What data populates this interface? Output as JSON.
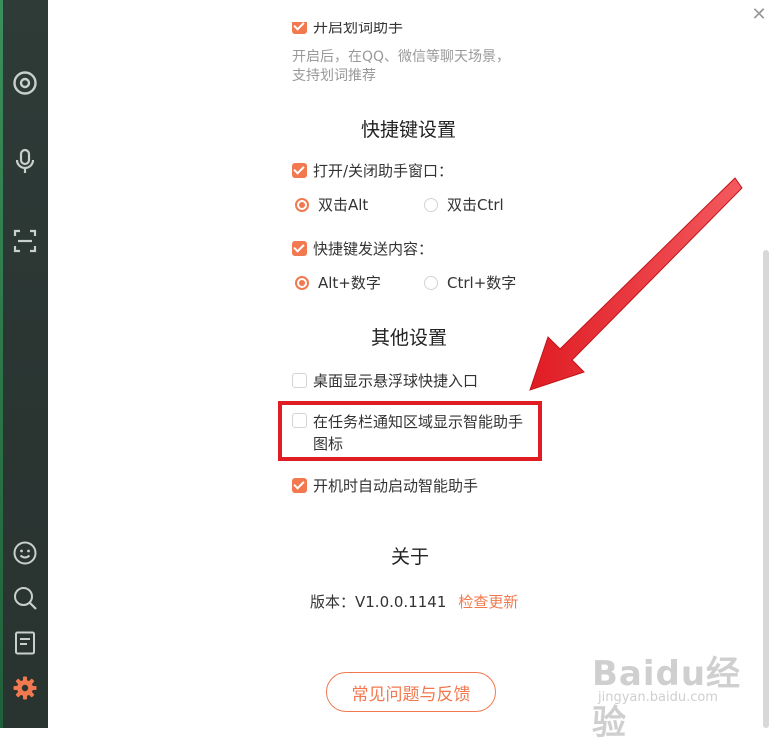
{
  "sidebar": {
    "icons": [
      "target-icon",
      "microphone-icon",
      "scan-icon",
      "smile-icon",
      "search-icon",
      "book-icon",
      "gear-icon"
    ]
  },
  "top": {
    "cut_label": "开启划词助手",
    "desc_line1": "开启后，在QQ、微信等聊天场景，",
    "desc_line2": "支持划词推荐"
  },
  "shortcut": {
    "title": "快捷键设置",
    "toggle_window_label": "打开/关闭助手窗口：",
    "radio_alt": "双击Alt",
    "radio_ctrl": "双击Ctrl",
    "send_label": "快捷键发送内容：",
    "radio_alt_num": "Alt+数字",
    "radio_ctrl_num": "Ctrl+数字"
  },
  "other": {
    "title": "其他设置",
    "desktop_float_label": "桌面显示悬浮球快捷入口",
    "tray_icon_line1": "在任务栏通知区域显示智能助手",
    "tray_icon_line2": "图标",
    "autostart_label": "开机时自动启动智能助手"
  },
  "about": {
    "title": "关于",
    "version": "版本：V1.0.0.1141",
    "check_update": "检查更新"
  },
  "feedback_button": "常见问题与反馈",
  "watermark": {
    "brand": "Baidu经验",
    "url": "jingyan.baidu.com"
  },
  "colors": {
    "accent": "#f2794f",
    "highlight": "#e01c24",
    "sidebar": "#2e3b37"
  }
}
